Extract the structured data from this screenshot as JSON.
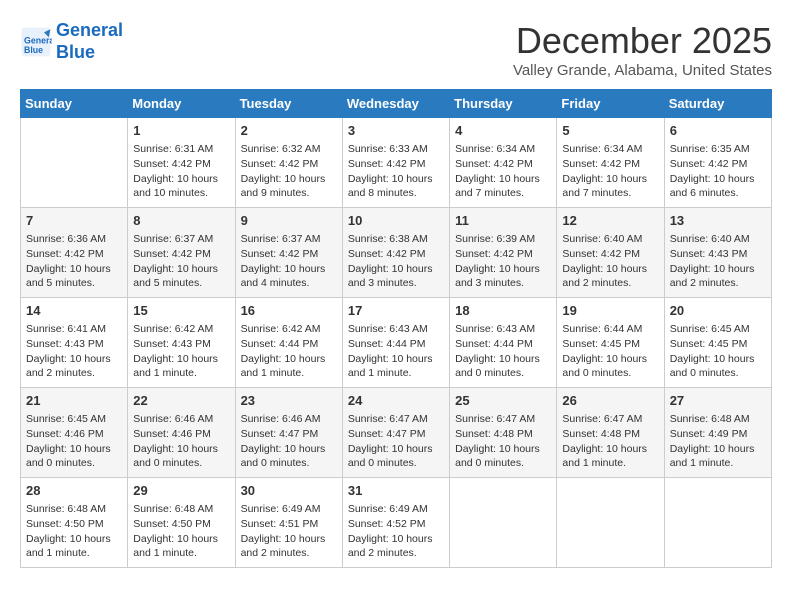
{
  "header": {
    "logo_line1": "General",
    "logo_line2": "Blue",
    "month_title": "December 2025",
    "location": "Valley Grande, Alabama, United States"
  },
  "days_of_week": [
    "Sunday",
    "Monday",
    "Tuesday",
    "Wednesday",
    "Thursday",
    "Friday",
    "Saturday"
  ],
  "weeks": [
    [
      {
        "day": "",
        "info": ""
      },
      {
        "day": "1",
        "info": "Sunrise: 6:31 AM\nSunset: 4:42 PM\nDaylight: 10 hours\nand 10 minutes."
      },
      {
        "day": "2",
        "info": "Sunrise: 6:32 AM\nSunset: 4:42 PM\nDaylight: 10 hours\nand 9 minutes."
      },
      {
        "day": "3",
        "info": "Sunrise: 6:33 AM\nSunset: 4:42 PM\nDaylight: 10 hours\nand 8 minutes."
      },
      {
        "day": "4",
        "info": "Sunrise: 6:34 AM\nSunset: 4:42 PM\nDaylight: 10 hours\nand 7 minutes."
      },
      {
        "day": "5",
        "info": "Sunrise: 6:34 AM\nSunset: 4:42 PM\nDaylight: 10 hours\nand 7 minutes."
      },
      {
        "day": "6",
        "info": "Sunrise: 6:35 AM\nSunset: 4:42 PM\nDaylight: 10 hours\nand 6 minutes."
      }
    ],
    [
      {
        "day": "7",
        "info": "Sunrise: 6:36 AM\nSunset: 4:42 PM\nDaylight: 10 hours\nand 5 minutes."
      },
      {
        "day": "8",
        "info": "Sunrise: 6:37 AM\nSunset: 4:42 PM\nDaylight: 10 hours\nand 5 minutes."
      },
      {
        "day": "9",
        "info": "Sunrise: 6:37 AM\nSunset: 4:42 PM\nDaylight: 10 hours\nand 4 minutes."
      },
      {
        "day": "10",
        "info": "Sunrise: 6:38 AM\nSunset: 4:42 PM\nDaylight: 10 hours\nand 3 minutes."
      },
      {
        "day": "11",
        "info": "Sunrise: 6:39 AM\nSunset: 4:42 PM\nDaylight: 10 hours\nand 3 minutes."
      },
      {
        "day": "12",
        "info": "Sunrise: 6:40 AM\nSunset: 4:42 PM\nDaylight: 10 hours\nand 2 minutes."
      },
      {
        "day": "13",
        "info": "Sunrise: 6:40 AM\nSunset: 4:43 PM\nDaylight: 10 hours\nand 2 minutes."
      }
    ],
    [
      {
        "day": "14",
        "info": "Sunrise: 6:41 AM\nSunset: 4:43 PM\nDaylight: 10 hours\nand 2 minutes."
      },
      {
        "day": "15",
        "info": "Sunrise: 6:42 AM\nSunset: 4:43 PM\nDaylight: 10 hours\nand 1 minute."
      },
      {
        "day": "16",
        "info": "Sunrise: 6:42 AM\nSunset: 4:44 PM\nDaylight: 10 hours\nand 1 minute."
      },
      {
        "day": "17",
        "info": "Sunrise: 6:43 AM\nSunset: 4:44 PM\nDaylight: 10 hours\nand 1 minute."
      },
      {
        "day": "18",
        "info": "Sunrise: 6:43 AM\nSunset: 4:44 PM\nDaylight: 10 hours\nand 0 minutes."
      },
      {
        "day": "19",
        "info": "Sunrise: 6:44 AM\nSunset: 4:45 PM\nDaylight: 10 hours\nand 0 minutes."
      },
      {
        "day": "20",
        "info": "Sunrise: 6:45 AM\nSunset: 4:45 PM\nDaylight: 10 hours\nand 0 minutes."
      }
    ],
    [
      {
        "day": "21",
        "info": "Sunrise: 6:45 AM\nSunset: 4:46 PM\nDaylight: 10 hours\nand 0 minutes."
      },
      {
        "day": "22",
        "info": "Sunrise: 6:46 AM\nSunset: 4:46 PM\nDaylight: 10 hours\nand 0 minutes."
      },
      {
        "day": "23",
        "info": "Sunrise: 6:46 AM\nSunset: 4:47 PM\nDaylight: 10 hours\nand 0 minutes."
      },
      {
        "day": "24",
        "info": "Sunrise: 6:47 AM\nSunset: 4:47 PM\nDaylight: 10 hours\nand 0 minutes."
      },
      {
        "day": "25",
        "info": "Sunrise: 6:47 AM\nSunset: 4:48 PM\nDaylight: 10 hours\nand 0 minutes."
      },
      {
        "day": "26",
        "info": "Sunrise: 6:47 AM\nSunset: 4:48 PM\nDaylight: 10 hours\nand 1 minute."
      },
      {
        "day": "27",
        "info": "Sunrise: 6:48 AM\nSunset: 4:49 PM\nDaylight: 10 hours\nand 1 minute."
      }
    ],
    [
      {
        "day": "28",
        "info": "Sunrise: 6:48 AM\nSunset: 4:50 PM\nDaylight: 10 hours\nand 1 minute."
      },
      {
        "day": "29",
        "info": "Sunrise: 6:48 AM\nSunset: 4:50 PM\nDaylight: 10 hours\nand 1 minute."
      },
      {
        "day": "30",
        "info": "Sunrise: 6:49 AM\nSunset: 4:51 PM\nDaylight: 10 hours\nand 2 minutes."
      },
      {
        "day": "31",
        "info": "Sunrise: 6:49 AM\nSunset: 4:52 PM\nDaylight: 10 hours\nand 2 minutes."
      },
      {
        "day": "",
        "info": ""
      },
      {
        "day": "",
        "info": ""
      },
      {
        "day": "",
        "info": ""
      }
    ]
  ]
}
